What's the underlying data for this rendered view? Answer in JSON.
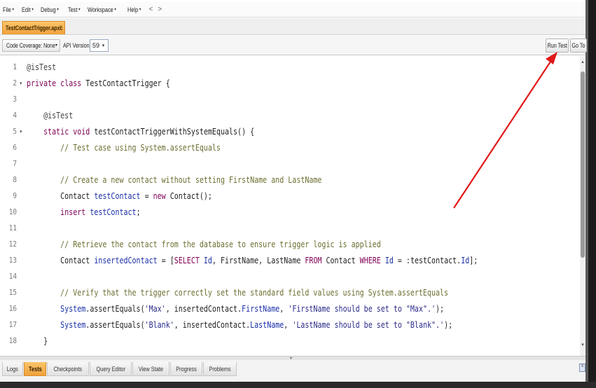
{
  "menu": {
    "items": [
      {
        "label": "File",
        "caret": "▾"
      },
      {
        "label": "Edit",
        "caret": "▾"
      },
      {
        "label": "Debug",
        "caret": "▾"
      },
      {
        "label": "Test",
        "caret": "▾"
      },
      {
        "label": "Workspace",
        "caret": "▾"
      },
      {
        "label": "Help",
        "caret": "▾"
      }
    ],
    "back_glyph": "<",
    "forward_glyph": ">"
  },
  "tabs": {
    "file_tab_label": "TestContactTrigger.apxc",
    "close_glyph": "×"
  },
  "toolbar": {
    "coverage_label": "Code Coverage: None",
    "coverage_caret": "▾",
    "api_label": "API Version:",
    "api_value": "59",
    "api_caret": "▾",
    "run_test_label": "Run Test",
    "go_to_label": "Go To"
  },
  "editor": {
    "lines": [
      {
        "n": "1",
        "fold": ""
      },
      {
        "n": "2",
        "fold": "▾"
      },
      {
        "n": "3",
        "fold": ""
      },
      {
        "n": "4",
        "fold": ""
      },
      {
        "n": "5",
        "fold": "▾"
      },
      {
        "n": "6",
        "fold": ""
      },
      {
        "n": "7",
        "fold": ""
      },
      {
        "n": "8",
        "fold": ""
      },
      {
        "n": "9",
        "fold": ""
      },
      {
        "n": "10",
        "fold": ""
      },
      {
        "n": "11",
        "fold": ""
      },
      {
        "n": "12",
        "fold": ""
      },
      {
        "n": "13",
        "fold": ""
      },
      {
        "n": "14",
        "fold": ""
      },
      {
        "n": "15",
        "fold": ""
      },
      {
        "n": "16",
        "fold": ""
      },
      {
        "n": "17",
        "fold": ""
      },
      {
        "n": "18",
        "fold": ""
      }
    ],
    "code": {
      "l1": {
        "a": "@isTest"
      },
      "l2": {
        "a": "private",
        "b": " ",
        "c": "class",
        "d": " TestContactTrigger {"
      },
      "l4": {
        "a": "    @isTest"
      },
      "l5": {
        "a": "    ",
        "b": "static",
        "c": " ",
        "d": "void",
        "e": " testContactTriggerWithSystemEquals() {"
      },
      "l6": {
        "a": "        // Test case using System.assertEquals"
      },
      "l8": {
        "a": "        // Create a new contact without setting FirstName and LastName"
      },
      "l9": {
        "a": "        Contact ",
        "b": "testContact",
        "c": " = ",
        "d": "new",
        "e": " Contact();"
      },
      "l10": {
        "a": "        ",
        "b": "insert",
        "c": " ",
        "d": "testContact",
        "e": ";"
      },
      "l12": {
        "a": "        // Retrieve the contact from the database to ensure trigger logic is applied"
      },
      "l13": {
        "a": "        Contact ",
        "b": "insertedContact",
        "c": " = [",
        "d": "SELECT",
        "e": " ",
        "f": "Id",
        "g": ", FirstName, LastName ",
        "h": "FROM",
        "i": " Contact ",
        "j": "WHERE",
        "k": " ",
        "l": "Id",
        "m": " = :testContact.",
        "n": "Id",
        "o": "];"
      },
      "l15": {
        "a": "        // Verify that the trigger correctly set the standard field values using System.assertEquals"
      },
      "l16": {
        "a": "        ",
        "b": "System",
        "c": ".assertEquals(",
        "d": "'Max'",
        "e": ", insertedContact.",
        "f": "FirstName",
        "g": ", ",
        "h": "'FirstName should be set to \"Max\".'",
        "i": ");"
      },
      "l17": {
        "a": "        ",
        "b": "System",
        "c": ".assertEquals(",
        "d": "'Blank'",
        "e": ", insertedContact.",
        "f": "LastName",
        "g": ", ",
        "h": "'LastName should be set to \"Blank\".'",
        "i": ");"
      },
      "l18": {
        "a": "    }"
      }
    }
  },
  "bottom_tabs": [
    {
      "label": "Logs",
      "active": false
    },
    {
      "label": "Tests",
      "active": true
    },
    {
      "label": "Checkpoints",
      "active": false
    },
    {
      "label": "Query Editor",
      "active": false
    },
    {
      "label": "View State",
      "active": false
    },
    {
      "label": "Progress",
      "active": false
    },
    {
      "label": "Problems",
      "active": false
    }
  ],
  "colors": {
    "active_tab": "#f0a13b",
    "keyword": "#7f0055",
    "comment": "#6e6e32",
    "field": "#1a2fa8",
    "annotation_arrow": "#e01818"
  },
  "icons": {
    "scroll_up": "▲",
    "scroll_down": "▼",
    "splitter_grip": "▾",
    "panel_icon": "≡"
  }
}
